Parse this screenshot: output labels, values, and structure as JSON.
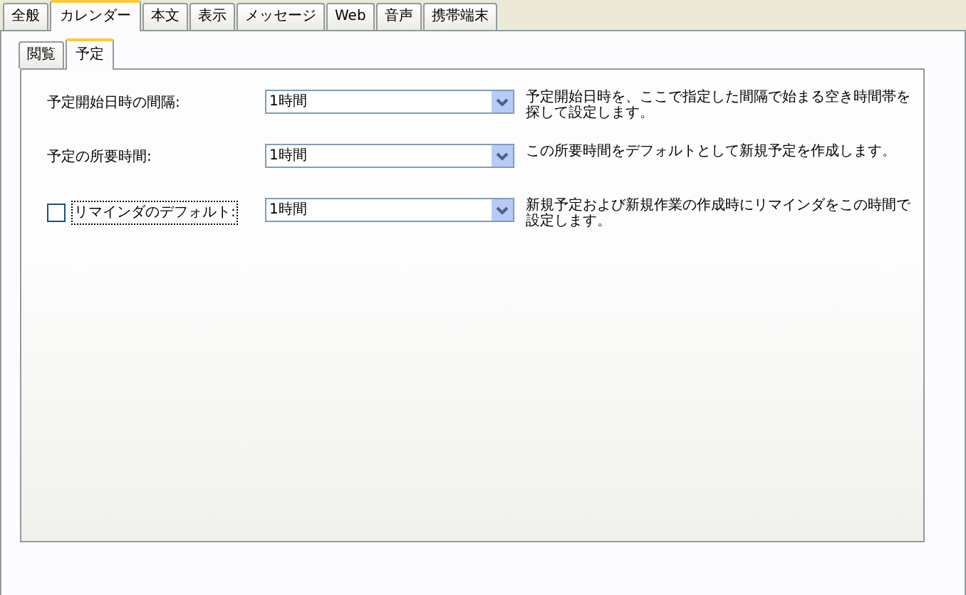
{
  "tabs": [
    {
      "label": "全般",
      "selected": false
    },
    {
      "label": "カレンダー",
      "selected": true
    },
    {
      "label": "本文",
      "selected": false
    },
    {
      "label": "表示",
      "selected": false
    },
    {
      "label": "メッセージ",
      "selected": false
    },
    {
      "label": "Web",
      "selected": false
    },
    {
      "label": "音声",
      "selected": false
    },
    {
      "label": "携帯端末",
      "selected": false
    }
  ],
  "subtabs": [
    {
      "label": "閲覧",
      "selected": false
    },
    {
      "label": "予定",
      "selected": true
    }
  ],
  "settings": [
    {
      "kind": "label",
      "label": "予定開始日時の間隔:",
      "value": "1時間",
      "description": "予定開始日時を、ここで指定した間隔で始まる空き時間帯を探して設定します。"
    },
    {
      "kind": "label",
      "label": "予定の所要時間:",
      "value": "1時間",
      "description": "この所要時間をデフォルトとして新規予定を作成します。"
    },
    {
      "kind": "checkbox",
      "label": "リマインダのデフォルト:",
      "checked": false,
      "value": "1時間",
      "description": "新規予定および新規作業の作成時にリマインダをこの時間で設定します。"
    }
  ]
}
